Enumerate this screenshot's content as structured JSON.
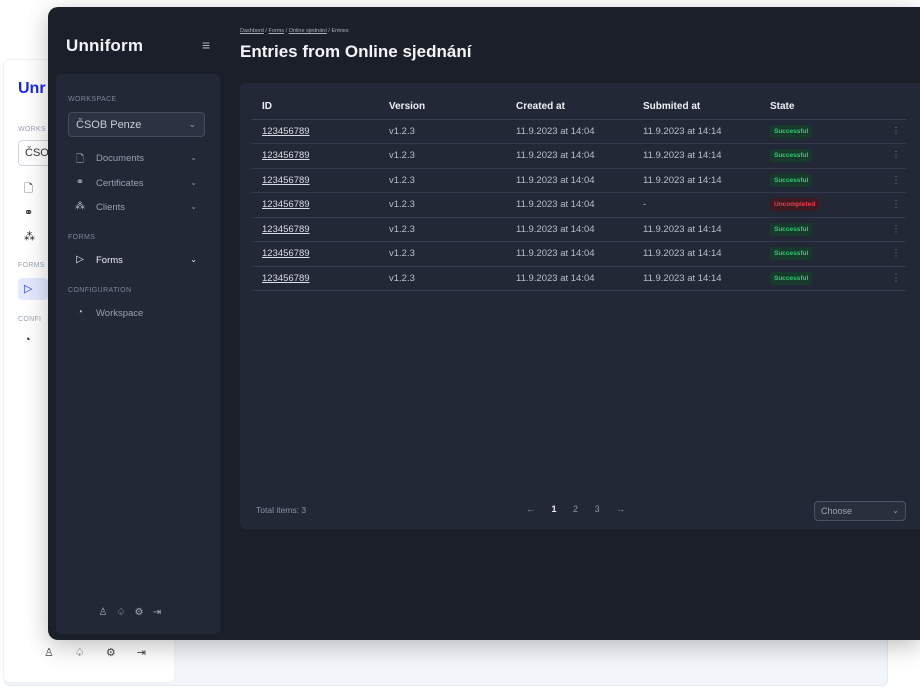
{
  "background_app": {
    "logo": "Unr",
    "workspace_label": "WORKS",
    "workspace_value": "ČSO",
    "forms_label": "FORMS",
    "config_label": "CONFI"
  },
  "app": {
    "logo": "Unniform",
    "menu_icon": "hamburger-icon"
  },
  "sidebar": {
    "workspace_label": "WORKSPACE",
    "workspace_selected": "ČSOB Penze",
    "items": [
      {
        "label": "Documents",
        "icon": "document-icon",
        "has_chevron": true
      },
      {
        "label": "Certificates",
        "icon": "certificate-icon",
        "has_chevron": true
      },
      {
        "label": "Clients",
        "icon": "clients-icon",
        "has_chevron": true
      }
    ],
    "forms_label": "FORMS",
    "forms_item": {
      "label": "Forms",
      "icon": "forms-icon",
      "active": true
    },
    "config_label": "CONFIGURATION",
    "config_item": {
      "label": "Workspace",
      "icon": "palette-icon"
    },
    "bottom_icons": [
      "user-icon",
      "bell-icon",
      "settings-icon",
      "logout-icon"
    ]
  },
  "header": {
    "breadcrumb": [
      "Dashbord",
      "Forms",
      "Online sjednání",
      "Entries"
    ],
    "title": "Entries from Online sjednání"
  },
  "table": {
    "columns": [
      "ID",
      "Version",
      "Created at",
      "Submited at",
      "State"
    ],
    "rows": [
      {
        "id": "123456789",
        "version": "v1.2.3",
        "created": "11.9.2023 at 14:04",
        "submitted": "11.9.2023 at 14:14",
        "state": "Successful",
        "status": "ok"
      },
      {
        "id": "123456789",
        "version": "v1.2.3",
        "created": "11.9.2023 at 14:04",
        "submitted": "11.9.2023 at 14:14",
        "state": "Successful",
        "status": "ok"
      },
      {
        "id": "123456789",
        "version": "v1.2.3",
        "created": "11.9.2023 at 14:04",
        "submitted": "11.9.2023 at 14:14",
        "state": "Successful",
        "status": "ok"
      },
      {
        "id": "123456789",
        "version": "v1.2.3",
        "created": "11.9.2023 at 14:04",
        "submitted": "-",
        "state": "Uncompleted",
        "status": "err"
      },
      {
        "id": "123456789",
        "version": "v1.2.3",
        "created": "11.9.2023 at 14:04",
        "submitted": "11.9.2023 at 14:14",
        "state": "Successful",
        "status": "ok"
      },
      {
        "id": "123456789",
        "version": "v1.2.3",
        "created": "11.9.2023 at 14:04",
        "submitted": "11.9.2023 at 14:14",
        "state": "Successful",
        "status": "ok"
      },
      {
        "id": "123456789",
        "version": "v1.2.3",
        "created": "11.9.2023 at 14:04",
        "submitted": "11.9.2023 at 14:14",
        "state": "Successful",
        "status": "ok"
      }
    ]
  },
  "footer": {
    "total": "Total items: 3",
    "pages": [
      "1",
      "2",
      "3"
    ],
    "current_page": "1",
    "prev": "←",
    "next": "→",
    "page_size_placeholder": "Choose"
  },
  "colors": {
    "success": "#2ecc71",
    "error": "#ef3b4f",
    "bg": "#1b1f2a",
    "panel": "#232837"
  }
}
